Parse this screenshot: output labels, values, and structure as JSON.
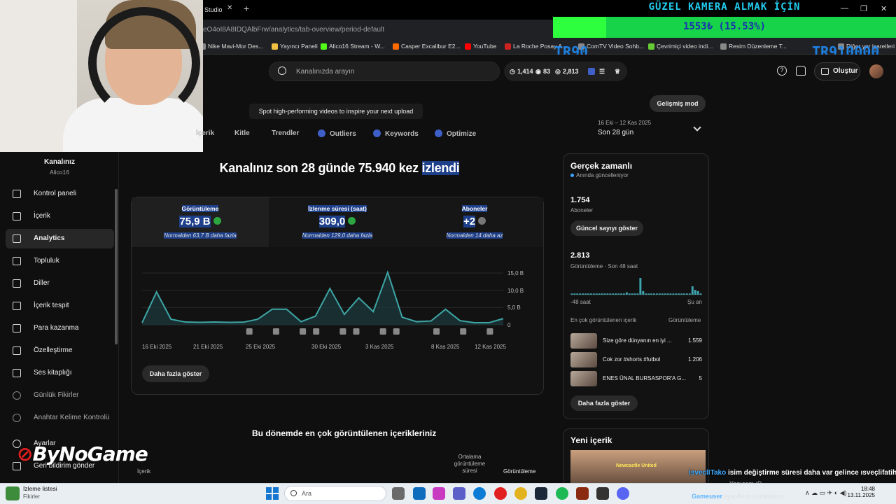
{
  "browser": {
    "tab_title": "Studio",
    "url": "eO4oI8A8IDQAlbFrw/analytics/tab-overview/period-default",
    "bookmarks": [
      "Nike Mavi-Mor Des...",
      "Yayıncı Paneli",
      "Alico16 Stream - W...",
      "Casper Excalibur E2...",
      "YouTube",
      "La Roche Posay A...",
      "ComTV Video Sohb...",
      "Çevrimiçi video indi...",
      "Resim Düzenleme T...",
      "Diğer yer işaretleri"
    ],
    "bookmark_colors": [
      "#aaaaaa",
      "#f0c040",
      "#53fc18",
      "#ff6a00",
      "#ff0000",
      "#cc2222",
      "#888888",
      "#66cc33",
      "#aaaaaa",
      "#888888"
    ]
  },
  "overlay": {
    "goal_title": "GÜZEL KAMERA ALMAK İÇİN",
    "goal_progress": "1553₺ (15.53%)",
    "goal_fraction": 0.1553,
    "text_left": "TR90",
    "text_right": "TR910000",
    "brand_logo": "ByNoGame"
  },
  "header": {
    "search_placeholder": "Kanalınızda arayın",
    "stat1": "1,414",
    "stat2": "83",
    "stat3": "2,813",
    "create_label": "Oluştur"
  },
  "sidebar": {
    "channel_title": "Kanalınız",
    "channel_name": "Alico16",
    "items": [
      {
        "label": "Kontrol paneli",
        "icon": "dashboard-icon"
      },
      {
        "label": "İçerik",
        "icon": "content-icon"
      },
      {
        "label": "Analytics",
        "icon": "analytics-icon"
      },
      {
        "label": "Topluluk",
        "icon": "community-icon"
      },
      {
        "label": "Diller",
        "icon": "subtitles-icon"
      },
      {
        "label": "İçerik tespit",
        "icon": "copyright-icon"
      },
      {
        "label": "Para kazanma",
        "icon": "dollar-icon"
      },
      {
        "label": "Özelleştirme",
        "icon": "customization-icon"
      },
      {
        "label": "Ses kitaplığı",
        "icon": "audio-library-icon"
      },
      {
        "label": "Günlük Fikirler",
        "icon": "ideas-icon"
      },
      {
        "label": "Anahtar Kelime Kontrolü",
        "icon": "keyword-icon"
      }
    ],
    "settings_label": "Ayarlar",
    "feedback_label": "Geri bildirim gönder"
  },
  "tabs": {
    "items": [
      "İçerik",
      "Kitle",
      "Trendler",
      "Outliers",
      "Keywords",
      "Optimize"
    ],
    "tooltip": "Spot high-performing videos to inspire your next upload",
    "advanced_mode": "Gelişmiş mod",
    "period_range": "16 Eki – 12 Kas 2025",
    "period_label": "Son 28 gün"
  },
  "overview": {
    "headline_a": "Kanalınız son 28 günde 75.940 kez ",
    "headline_b": "izlendi",
    "metrics": [
      {
        "label": "Görüntüleme",
        "value": "75,9 B",
        "sub": "Normalden 63,7 B daha fazla",
        "trend": "up"
      },
      {
        "label": "İzlenme süresi (saat)",
        "value": "309,0",
        "sub": "Normalden 129,0 daha fazla",
        "trend": "up"
      },
      {
        "label": "Aboneler",
        "value": "+2",
        "sub": "Normalden 14 daha az",
        "trend": "down"
      }
    ],
    "more_button": "Daha fazla göster",
    "top_content_title": "Bu dönemde en çok görüntülenen içerikleriniz",
    "col_content": "İçerik",
    "col_avg": "Ortalama görüntüleme süresi",
    "col_views": "Görüntüleme"
  },
  "chart_data": {
    "type": "area",
    "x_ticks": [
      "16 Eki 2025",
      "21 Eki 2025",
      "25 Eki 2025",
      "30 Eki 2025",
      "3 Kas 2025",
      "8 Kas 2025",
      "12 Kas 2025"
    ],
    "y_ticks": [
      "15,0 B",
      "10,0 B",
      "5,0 B",
      "0"
    ],
    "ylim": [
      0,
      15000
    ],
    "values": [
      600,
      9500,
      1600,
      800,
      700,
      800,
      700,
      750,
      1600,
      4500,
      4500,
      900,
      2500,
      10500,
      3000,
      7800,
      3800,
      15200,
      2200,
      900,
      1100,
      4500,
      1200,
      600,
      600,
      1800
    ],
    "color": "#3ea6a6",
    "grid": true
  },
  "realtime": {
    "title": "Gerçek zamanlı",
    "subtitle": "Anında güncelleniyor",
    "subscribers_value": "1.754",
    "subscribers_label": "Aboneler",
    "live_button": "Güncel sayıyı göster",
    "views_value": "2.813",
    "views_label": "Görüntüleme · Son 48 saat",
    "bar_values": [
      1,
      1,
      1,
      1,
      1,
      1,
      1,
      1,
      1,
      1,
      1,
      1,
      1,
      1,
      1,
      1,
      1,
      1,
      1,
      1,
      2,
      1,
      1,
      1,
      1,
      14,
      3,
      1,
      1,
      1,
      1,
      1,
      1,
      1,
      1,
      1,
      1,
      1,
      1,
      1,
      1,
      1,
      1,
      1,
      7,
      4,
      3,
      1
    ],
    "axis_left": "-48 saat",
    "axis_right": "Şu an",
    "top_label": "En çok görüntülenen içerik",
    "top_col": "Görüntüleme",
    "videos": [
      {
        "title": "Size göre dünyanın en iyi ...",
        "views": "1.559"
      },
      {
        "title": "Cok zor #shorts #futbol",
        "views": "1.206"
      },
      {
        "title": "ENES ÜNAL BURSASPOR'A G...",
        "views": "5"
      }
    ],
    "more_button": "Daha fazla göster",
    "new_title": "Yeni içerik",
    "new_caption": "Newcastle United"
  },
  "chat": {
    "user1": "isveclITako",
    "msg1": "isim değiştirme süresi daha var gelince ısveçlifatih",
    "line2": "Yapıcam :D",
    "user3": "Gameuser",
    "msg3": "eyw Amin cümlemize"
  },
  "taskbar": {
    "widget_title": "İzleme listesi",
    "widget_sub": "Fikirler",
    "search_placeholder": "Ara",
    "time": "18:48",
    "date": "13.11.2025"
  }
}
